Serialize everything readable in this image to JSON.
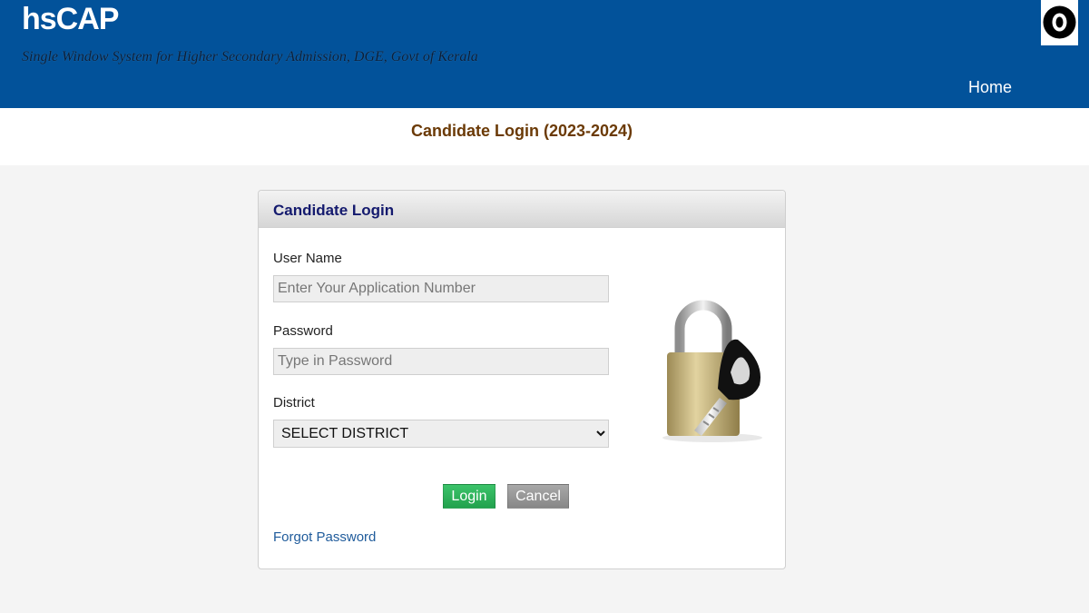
{
  "header": {
    "title": "hsCAP",
    "subtitle": "Single Window System for Higher Secondary Admission, DGE, Govt of Kerala",
    "nav": {
      "home_label": "Home"
    },
    "logo_icon": "circle-ring-logo-icon",
    "background_color": "#02529a"
  },
  "page": {
    "title": "Candidate Login (2023-2024)",
    "title_color": "#6b3a06"
  },
  "login_panel": {
    "title": "Candidate Login",
    "username": {
      "label": "User Name",
      "placeholder": "Enter Your Application Number",
      "value": ""
    },
    "password": {
      "label": "Password",
      "placeholder": "Type in Password",
      "value": ""
    },
    "district": {
      "label": "District",
      "selected": "SELECT DISTRICT"
    },
    "buttons": {
      "login_label": "Login",
      "cancel_label": "Cancel"
    },
    "forgot_password_label": "Forgot Password",
    "illustration_icon": "padlock-key-icon",
    "colors": {
      "login_button": "#2eb35c",
      "cancel_button": "#999999",
      "panel_title": "#141a6e",
      "link": "#1f5b9b"
    }
  }
}
